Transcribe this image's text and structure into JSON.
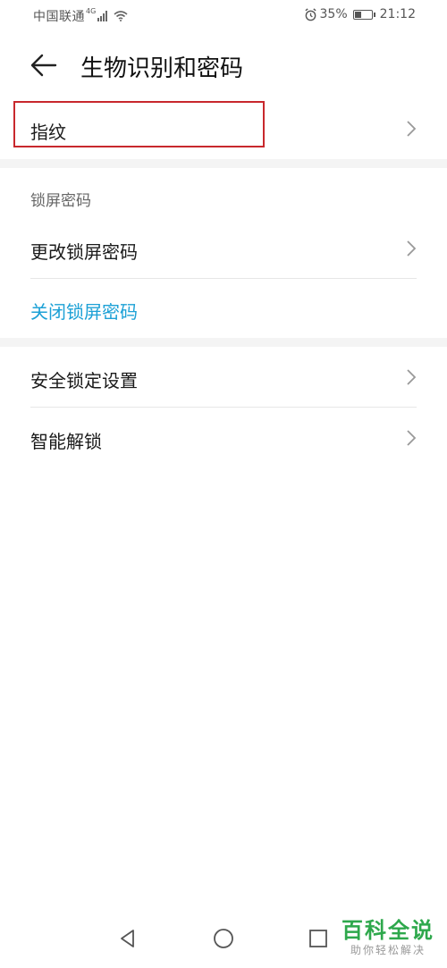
{
  "status_bar": {
    "carrier": "中国联通",
    "network_type": "4G",
    "battery_percent": "35%",
    "battery_level": 0.35,
    "time": "21:12",
    "icons": [
      "signal-icon",
      "wifi-icon",
      "alarm-icon",
      "battery-icon"
    ]
  },
  "header": {
    "title": "生物识别和密码",
    "back_icon": "back-arrow-icon"
  },
  "rows": {
    "fingerprint": "指纹",
    "lock_screen_section": "锁屏密码",
    "change_lock_password": "更改锁屏密码",
    "disable_lock_password": "关闭锁屏密码",
    "security_lock_settings": "安全锁定设置",
    "smart_unlock": "智能解锁"
  },
  "colors": {
    "link": "#1da1d6",
    "highlight": "#c8282d",
    "watermark": "#2ea84c"
  },
  "nav_bar": {
    "icons": [
      "nav-back-icon",
      "nav-home-icon",
      "nav-recents-icon"
    ]
  },
  "watermark": {
    "title": "百科全说",
    "subtitle": "助你轻松解决"
  }
}
